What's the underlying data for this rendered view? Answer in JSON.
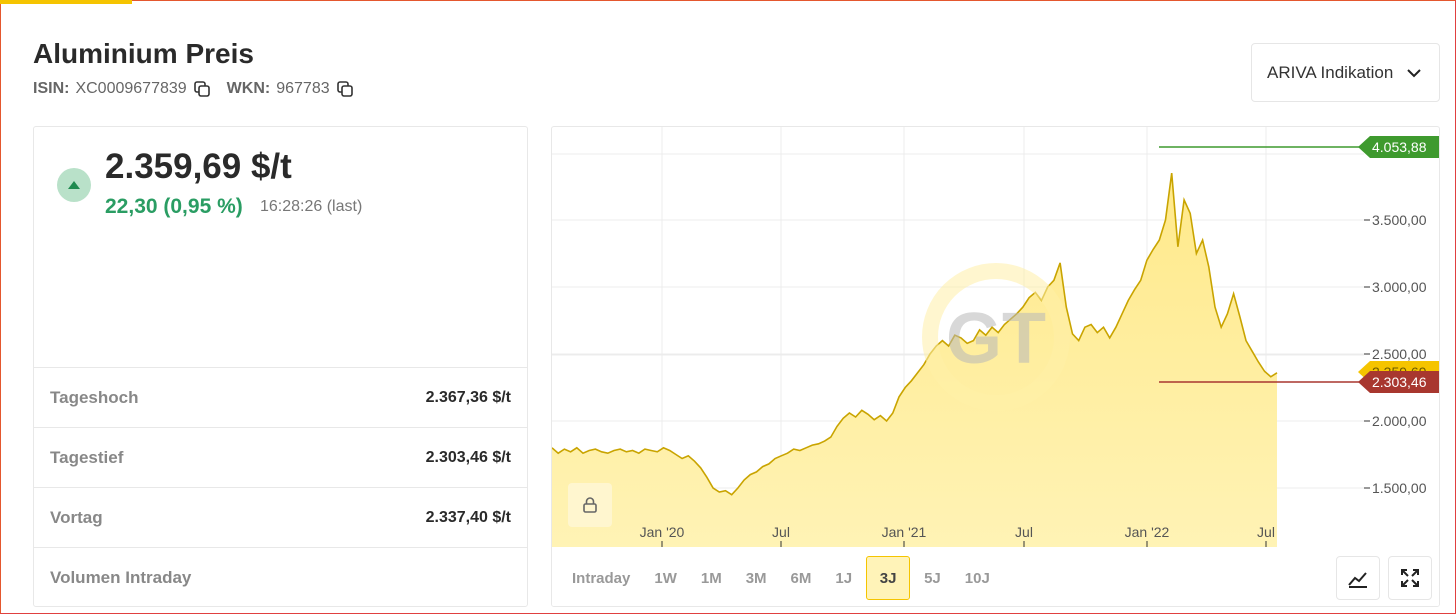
{
  "header": {
    "title": "Aluminium Preis",
    "isin_label": "ISIN:",
    "isin_value": "XC0009677839",
    "wkn_label": "WKN:",
    "wkn_value": "967783"
  },
  "source_dropdown": {
    "selected": "ARIVA Indikation"
  },
  "quote": {
    "price": "2.359,69 $/t",
    "change": "22,30 (0,95 %)",
    "time": "16:28:26 (last)",
    "direction": "up",
    "color_up": "#2a9d63"
  },
  "stats": [
    {
      "label": "Tageshoch",
      "value": "2.367,36 $/t"
    },
    {
      "label": "Tagestief",
      "value": "2.303,46 $/t"
    },
    {
      "label": "Vortag",
      "value": "2.337,40 $/t"
    },
    {
      "label": "Volumen Intraday",
      "value": ""
    }
  ],
  "chart_data": {
    "type": "area",
    "x_ticks": [
      "Jan '20",
      "Jul",
      "Jan '21",
      "Jul",
      "Jan '22",
      "Jul"
    ],
    "y_ticks": [
      "1.500,00",
      "2.000,00",
      "2.500,00",
      "3.000,00",
      "3.500,00"
    ],
    "ylim": [
      1200,
      4200
    ],
    "high_marker": "4.053,88",
    "low_marker": "2.303,46",
    "current_marker": "2.359,69",
    "series": [
      {
        "values": [
          1800,
          1760,
          1790,
          1770,
          1800,
          1760,
          1780,
          1790,
          1770,
          1760,
          1780,
          1790,
          1770,
          1780,
          1760,
          1790,
          1780,
          1770,
          1800,
          1780,
          1750,
          1720,
          1740,
          1700,
          1650,
          1580,
          1500,
          1470,
          1480,
          1450,
          1500,
          1560,
          1600,
          1620,
          1660,
          1680,
          1720,
          1740,
          1760,
          1790,
          1780,
          1800,
          1820,
          1830,
          1850,
          1880,
          1960,
          2020,
          2060,
          2030,
          2080,
          2050,
          2010,
          2040,
          2000,
          2060,
          2180,
          2250,
          2300,
          2360,
          2420,
          2500,
          2560,
          2600,
          2560,
          2640,
          2620,
          2580,
          2600,
          2680,
          2640,
          2700,
          2660,
          2720,
          2760,
          2800,
          2850,
          2920,
          2960,
          2900,
          3000,
          3050,
          3180,
          2850,
          2650,
          2600,
          2700,
          2720,
          2660,
          2700,
          2620,
          2700,
          2800,
          2900,
          2980,
          3050,
          3200,
          3280,
          3350,
          3500,
          3850,
          3300,
          3650,
          3550,
          3250,
          3350,
          3150,
          2850,
          2700,
          2800,
          2950,
          2780,
          2600,
          2520,
          2440,
          2370,
          2330,
          2360
        ]
      }
    ],
    "accent_color": "#f5c400",
    "high_color": "#3e9a2e",
    "low_color": "#a8372f"
  },
  "time_ranges": [
    "Intraday",
    "1W",
    "1M",
    "3M",
    "6M",
    "1J",
    "3J",
    "5J",
    "10J"
  ],
  "time_range_active": "3J",
  "watermark": "GT"
}
